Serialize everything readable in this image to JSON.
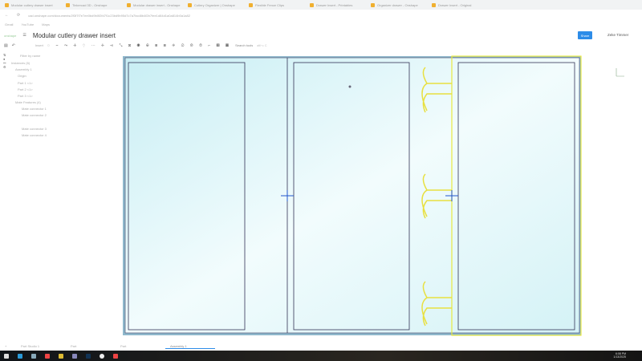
{
  "browser": {
    "tabs": [
      "Modular cutlery drawer insert",
      "Tinkercad 3D - Onshape",
      "Modular drawer insert - Onshape",
      "Cutlery Organizer | Onshape",
      "Flexible Fence Clips",
      "Drawer Insert - Printables",
      "Organizer drawer - Onshape",
      "Drawer Insert - Original"
    ],
    "url": "cad.onshape.com/documents/2f3f7f7e7ee0bd9b0f2fd7f1c23bd9b95d7c7a7bcd8b4f2b7fee1d84d1a0a814b0a1a82",
    "bookmarks": [
      "Gmail",
      "YouTube",
      "Maps"
    ]
  },
  "header": {
    "logo": "onshape",
    "doc_title": "Modular cutlery drawer insert",
    "share": "Share",
    "user": "Zeke Timmer"
  },
  "toolbar": {
    "insert": "Insert",
    "search": "Search tools",
    "shortcut": "alt/⌥ C"
  },
  "tree": {
    "filter": "Filter by name",
    "instances": "Instances (6)",
    "items": [
      "Assembly 1",
      "Origin",
      "Part 1 <1>",
      "Part 2 <1>",
      "Part 3 <1>",
      "Mate Features (4)",
      "Mate connector 1",
      "Mate connector 2",
      "Mate connector 3",
      "Mate connector 4"
    ]
  },
  "bottom_tabs": [
    "Part Studio 1",
    "Part",
    "Part",
    "Assembly 1"
  ],
  "taskbar": {
    "time": "6:08 PM",
    "date": "1/13/2025"
  },
  "colors": {
    "accent": "#2d8ce8",
    "selection": "#e8e840",
    "part": "#d8f4f8"
  }
}
